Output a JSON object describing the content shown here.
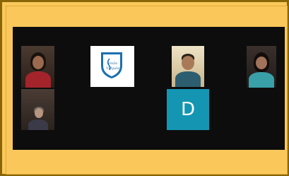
{
  "colors": {
    "outer_frame": "#fac85a",
    "screen_background": "#0d0d0d",
    "avatar_tile": "#1496b3",
    "logo_tile": "#ffffff",
    "logo_shield": "#1b6fb0"
  },
  "participants": [
    {
      "kind": "video",
      "description_icon": "person-video"
    },
    {
      "kind": "logo",
      "icon": "shield-logo-icon",
      "logo_text_1": "Smile",
      "logo_text_2": "Vidyalay"
    },
    {
      "kind": "video",
      "description_icon": "person-video"
    },
    {
      "kind": "video",
      "description_icon": "person-video"
    },
    {
      "kind": "video",
      "description_icon": "person-video"
    },
    {
      "kind": "avatar",
      "initial": "D"
    }
  ]
}
